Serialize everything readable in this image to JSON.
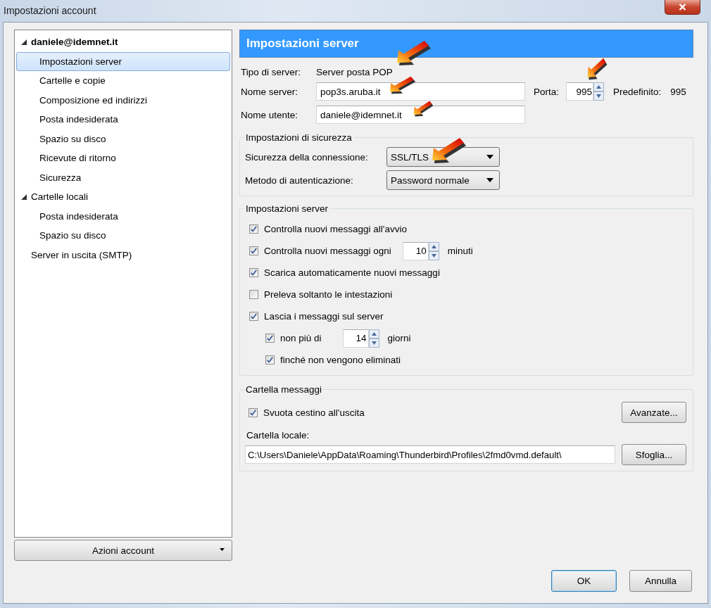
{
  "window": {
    "title": "Impostazioni account"
  },
  "tree": [
    {
      "label": "daniele@idemnet.it",
      "kind": "default_account",
      "expanded": true,
      "selected": false,
      "children": [
        {
          "label": "Impostazioni server",
          "selected": true
        },
        {
          "label": "Cartelle e copie",
          "selected": false
        },
        {
          "label": "Composizione ed indirizzi",
          "selected": false
        },
        {
          "label": "Posta indesiderata",
          "selected": false
        },
        {
          "label": "Spazio su disco",
          "selected": false
        },
        {
          "label": "Ricevute di ritorno",
          "selected": false
        },
        {
          "label": "Sicurezza",
          "selected": false
        }
      ]
    },
    {
      "label": "Cartelle locali",
      "kind": "account",
      "expanded": true,
      "selected": false,
      "children": [
        {
          "label": "Posta indesiderata",
          "selected": false
        },
        {
          "label": "Spazio su disco",
          "selected": false
        }
      ]
    },
    {
      "label": "Server in uscita (SMTP)",
      "kind": "smtp",
      "selected": false
    }
  ],
  "account_actions": {
    "label": "Azioni account"
  },
  "header": "Impostazioni server",
  "server_type": {
    "label": "Tipo di server:",
    "value": "Server posta POP"
  },
  "server_name": {
    "label": "Nome server:",
    "value": "pop3s.aruba.it"
  },
  "port": {
    "label": "Porta:",
    "value": "995"
  },
  "default_port": {
    "label": "Predefinito:",
    "value": "995"
  },
  "username": {
    "label": "Nome utente:",
    "value": "daniele@idemnet.it"
  },
  "security": {
    "legend": "Impostazioni di sicurezza",
    "connection": {
      "label": "Sicurezza della connessione:",
      "value": "SSL/TLS"
    },
    "auth": {
      "label": "Metodo di autenticazione:",
      "value": "Password normale"
    }
  },
  "server_settings": {
    "legend": "Impostazioni server",
    "options": [
      {
        "kind": "checkbox",
        "label": "Controlla nuovi messaggi all'avvio",
        "checked": true
      },
      {
        "kind": "spinner",
        "label": "Controlla nuovi messaggi ogni",
        "checked": true,
        "value": "10",
        "unit": "minuti"
      },
      {
        "kind": "checkbox",
        "label": "Scarica automaticamente nuovi messaggi",
        "checked": true
      },
      {
        "kind": "checkbox",
        "label": "Preleva soltanto le intestazioni",
        "checked": false
      },
      {
        "kind": "checkbox",
        "label": "Lascia i messaggi sul server",
        "checked": true,
        "children": [
          {
            "kind": "spinner",
            "label": "non più di",
            "checked": true,
            "value": "14",
            "unit": "giorni"
          },
          {
            "kind": "checkbox",
            "label": "finché non vengono eliminati",
            "checked": true
          }
        ]
      }
    ]
  },
  "message_folder": {
    "legend": "Cartella messaggi",
    "empty_trash": {
      "label": "Svuota cestino all'uscita",
      "checked": true
    },
    "advanced_button": "Avanzate...",
    "local_folder": {
      "label": "Cartella locale:",
      "value": "C:\\Users\\Daniele\\AppData\\Roaming\\Thunderbird\\Profiles\\2fmd0vmd.default\\"
    },
    "browse_button": "Sfoglia..."
  },
  "buttons": [
    {
      "label": "OK",
      "default": true
    },
    {
      "label": "Annulla",
      "default": false
    }
  ]
}
